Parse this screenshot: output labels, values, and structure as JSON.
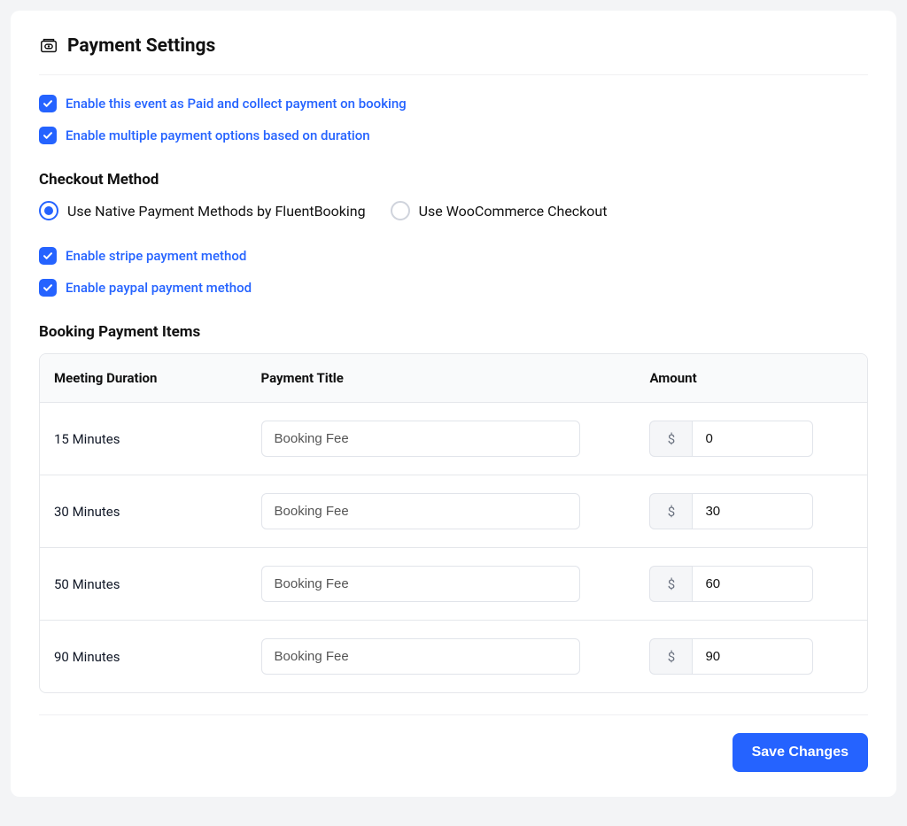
{
  "page_title": "Payment Settings",
  "checkboxes": {
    "enable_paid_event": {
      "label": "Enable this event as Paid and collect payment on booking",
      "checked": true
    },
    "enable_multi_duration": {
      "label": "Enable multiple payment options based on duration",
      "checked": true
    },
    "enable_stripe": {
      "label": "Enable stripe payment method",
      "checked": true
    },
    "enable_paypal": {
      "label": "Enable paypal payment method",
      "checked": true
    }
  },
  "checkout_method": {
    "heading": "Checkout Method",
    "options": {
      "native": {
        "label": "Use Native Payment Methods by FluentBooking",
        "selected": true
      },
      "woocommerce": {
        "label": "Use WooCommerce Checkout",
        "selected": false
      }
    }
  },
  "payment_items": {
    "heading": "Booking Payment Items",
    "columns": {
      "duration": "Meeting Duration",
      "title": "Payment Title",
      "amount": "Amount"
    },
    "currency_symbol": "$",
    "rows": [
      {
        "duration": "15 Minutes",
        "title": "Booking Fee",
        "amount": "0"
      },
      {
        "duration": "30 Minutes",
        "title": "Booking Fee",
        "amount": "30"
      },
      {
        "duration": "50 Minutes",
        "title": "Booking Fee",
        "amount": "60"
      },
      {
        "duration": "90 Minutes",
        "title": "Booking Fee",
        "amount": "90"
      }
    ]
  },
  "footer": {
    "save_label": "Save Changes"
  }
}
